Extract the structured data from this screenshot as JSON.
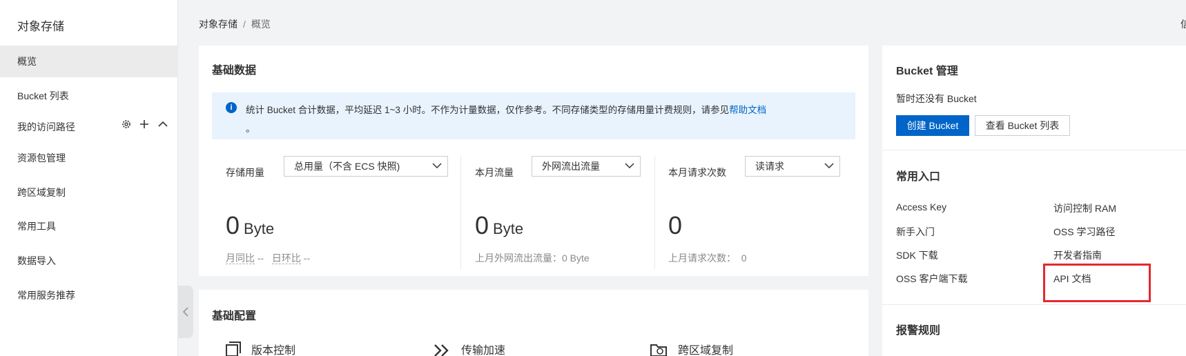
{
  "sidebar": {
    "title": "对象存储",
    "items": [
      {
        "label": "概览",
        "active": true
      },
      {
        "label": "Bucket 列表",
        "active": false
      },
      {
        "label": "资源包管理",
        "active": false
      },
      {
        "label": "跨区域复制",
        "active": false
      },
      {
        "label": "常用工具",
        "active": false
      },
      {
        "label": "数据导入",
        "active": false
      },
      {
        "label": "常用服务推荐",
        "active": false
      }
    ],
    "group": {
      "label": "我的访问路径",
      "icons": [
        "gear-icon",
        "plus-icon",
        "chevron-up-icon"
      ]
    },
    "collapse_icon": "chevron-left-icon"
  },
  "breadcrumb": {
    "parent": "对象存储",
    "separator": "/",
    "current": "概览"
  },
  "right_edge_text": "信",
  "basic_data": {
    "title": "基础数据",
    "notice_text": "统计 Bucket 合计数据，平均延迟 1~3 小时。不作为计量数据，仅作参考。不同存储类型的存储用量计费规则，请参见",
    "notice_link": "帮助文档",
    "notice_end": "。",
    "storage": {
      "label": "存储用量",
      "select": "总用量（不含 ECS 快照)",
      "value": "0",
      "unit": "Byte",
      "sub_mom": "月同比",
      "sub_mom_value": "--",
      "sub_dod": "日环比",
      "sub_dod_value": "--"
    },
    "traffic": {
      "label": "本月流量",
      "select": "外网流出流量",
      "value": "0",
      "unit": "Byte",
      "sub": "上月外网流出流量：0 Byte"
    },
    "requests": {
      "label": "本月请求次数",
      "select": "读请求",
      "value": "0",
      "sub": "上月请求次数：",
      "sub_value": "0"
    }
  },
  "basic_config": {
    "title": "基础配置",
    "items": [
      "版本控制",
      "传输加速",
      "跨区域复制"
    ]
  },
  "bucket_mgmt": {
    "title": "Bucket 管理",
    "empty_text": "暂时还没有 Bucket",
    "create_button": "创建 Bucket",
    "view_button": "查看 Bucket 列表"
  },
  "quick_entry": {
    "title": "常用入口",
    "left": [
      "Access Key",
      "新手入门",
      "SDK 下载",
      "OSS 客户端下载"
    ],
    "right": [
      "访问控制 RAM",
      "OSS 学习路径",
      "开发者指南",
      "API 文档"
    ]
  },
  "alarm": {
    "title": "报警规则"
  },
  "colors": {
    "primary": "#0064c8",
    "accent": "#ff6a00",
    "highlight": "#e5282e"
  }
}
